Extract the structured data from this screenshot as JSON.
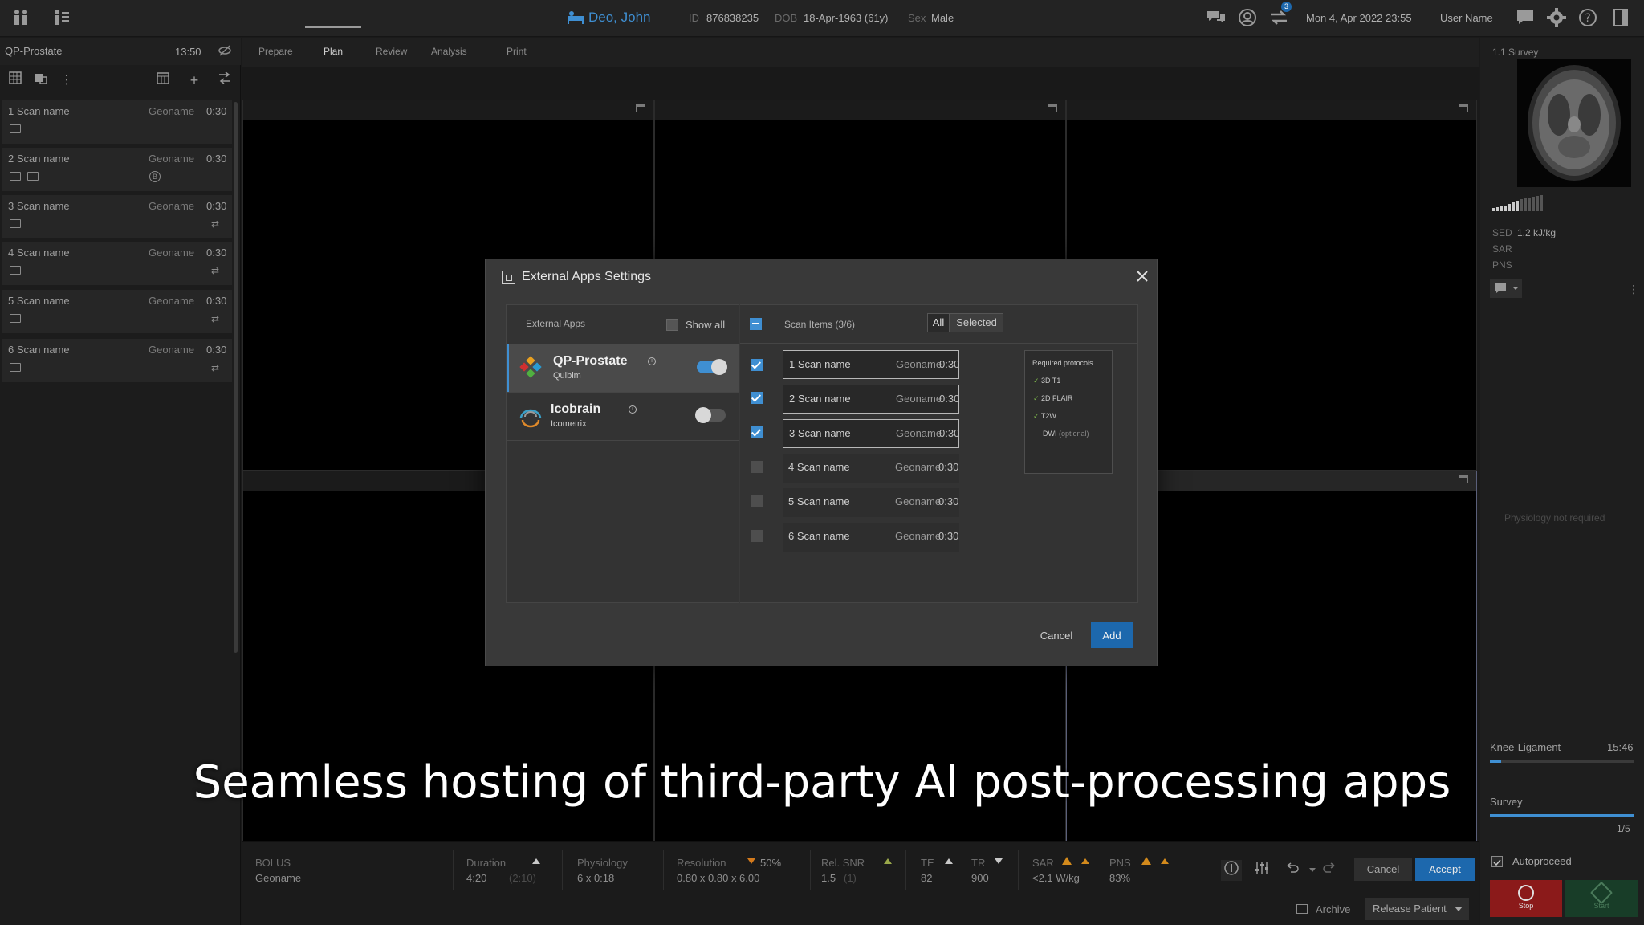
{
  "topbar": {
    "patient_name": "Deo, John",
    "id_label": "ID",
    "id_value": "876838235",
    "dob_label": "DOB",
    "dob_value": "18-Apr-1963 (61y)",
    "sex_label": "Sex",
    "sex_value": "Male",
    "notification_count": "3",
    "datetime": "Mon 4, Apr 2022  23:55",
    "username": "User Name"
  },
  "left_panel": {
    "title": "QP-Prostate",
    "time": "13:50",
    "scans": [
      {
        "name": "1 Scan name",
        "geo": "Geoname",
        "dur": "0:30"
      },
      {
        "name": "2 Scan name",
        "geo": "Geoname",
        "dur": "0:30",
        "badge": "B"
      },
      {
        "name": "3 Scan name",
        "geo": "Geoname",
        "dur": "0:30"
      },
      {
        "name": "4 Scan name",
        "geo": "Geoname",
        "dur": "0:30"
      },
      {
        "name": "5 Scan name",
        "geo": "Geoname",
        "dur": "0:30"
      },
      {
        "name": "6 Scan name",
        "geo": "Geoname",
        "dur": "0:30"
      }
    ]
  },
  "tabs": [
    {
      "label": "Prepare"
    },
    {
      "label": "Plan"
    },
    {
      "label": "Review"
    },
    {
      "label": "Analysis"
    },
    {
      "label": "Print"
    }
  ],
  "right_panel": {
    "survey_label": "1.1 Survey",
    "sed_label": "SED",
    "sed_value": "1.2 kJ/kg",
    "sar_label": "SAR",
    "pns_label": "PNS",
    "physiology_note": "Physiology not required",
    "protocol_name": "Knee-Ligament",
    "protocol_time": "15:46",
    "survey2_label": "Survey",
    "progress_count": "1/5",
    "autoproceed_label": "Autoproceed",
    "stop_label": "Stop",
    "start_label": "Start"
  },
  "bottom_bar": {
    "bolus_label": "BOLUS",
    "bolus_value": "Geoname",
    "duration_label": "Duration",
    "duration_value": "4:20",
    "duration_sub": "(2:10)",
    "physiology_label": "Physiology",
    "physiology_value": "6 x 0:18",
    "resolution_label": "Resolution",
    "resolution_pct": "50%",
    "resolution_value": "0.80 x 0.80 x 6.00",
    "relsnr_label": "Rel. SNR",
    "relsnr_value": "1.5",
    "relsnr_sub": "(1)",
    "te_label": "TE",
    "te_value": "82",
    "tr_label": "TR",
    "tr_value": "900",
    "sar_label": "SAR",
    "sar_value": "<2.1 W/kg",
    "pns_label": "PNS",
    "pns_value": "83%",
    "cancel_label": "Cancel",
    "accept_label": "Accept",
    "archive_label": "Archive",
    "release_label": "Release Patient"
  },
  "modal": {
    "title": "External Apps Settings",
    "apps_header": "External Apps",
    "show_all_label": "Show all",
    "apps": [
      {
        "name": "QP-Prostate",
        "vendor": "Quibim",
        "enabled": true
      },
      {
        "name": "Icobrain",
        "vendor": "Icometrix",
        "enabled": false
      }
    ],
    "scans_header": "Scan Items (3/6)",
    "filter_all": "All",
    "filter_selected": "Selected",
    "scans": [
      {
        "name": "1 Scan name",
        "geo": "Geoname",
        "dur": "0:30",
        "checked": true
      },
      {
        "name": "2 Scan name",
        "geo": "Geoname",
        "dur": "0:30",
        "checked": true
      },
      {
        "name": "3 Scan name",
        "geo": "Geoname",
        "dur": "0:30",
        "checked": true
      },
      {
        "name": "4 Scan name",
        "geo": "Geoname",
        "dur": "0:30",
        "checked": false
      },
      {
        "name": "5 Scan name",
        "geo": "Geoname",
        "dur": "0:30",
        "checked": false
      },
      {
        "name": "6 Scan name",
        "geo": "Geoname",
        "dur": "0:30",
        "checked": false
      }
    ],
    "required_title": "Required protocols",
    "required": [
      {
        "name": "3D T1",
        "check": true,
        "note": ""
      },
      {
        "name": "2D FLAIR",
        "check": true,
        "note": ""
      },
      {
        "name": "T2W",
        "check": true,
        "note": ""
      },
      {
        "name": "DWI",
        "check": false,
        "note": "(optional)"
      }
    ],
    "cancel_label": "Cancel",
    "add_label": "Add"
  },
  "caption": "Seamless hosting of third-party AI post-processing apps",
  "colors": {
    "accent": "#1d68ad",
    "patient": "#3f8fd2",
    "stop": "#8b1a1a",
    "start": "#183d28"
  }
}
